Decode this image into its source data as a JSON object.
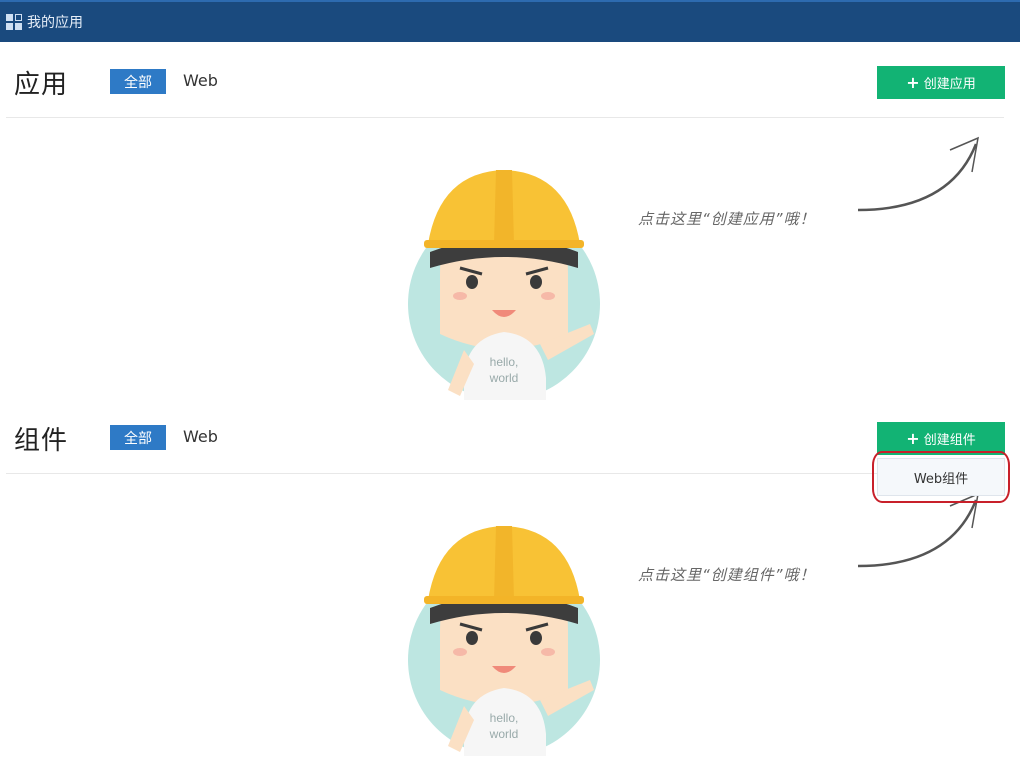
{
  "topbar": {
    "title": "我的应用",
    "icon": "grid-icon"
  },
  "apps_section": {
    "title": "应用",
    "filter_all": "全部",
    "filter_web": "Web",
    "create_label": "创建应用",
    "hint": "点击这里“创建应用”哦！",
    "illustration_text": "hello,\nworld"
  },
  "components_section": {
    "title": "组件",
    "filter_all": "全部",
    "filter_web": "Web",
    "create_label": "创建组件",
    "hint": "点击这里“创建组件”哦！",
    "illustration_text": "hello,\nworld",
    "dropdown_item": "Web组件"
  },
  "colors": {
    "topbar": "#1a4a7e",
    "accent_blue": "#2e7ac6",
    "create_green": "#12b374",
    "highlight_red": "#c8202a"
  }
}
